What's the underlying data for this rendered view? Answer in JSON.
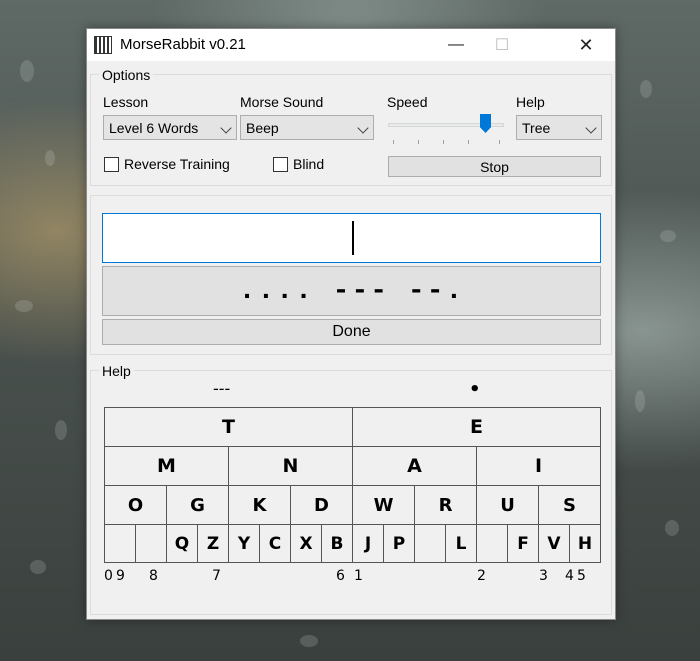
{
  "window": {
    "title": "MorseRabbit v0.21",
    "minimize": "—",
    "maximize": "☐",
    "close": "✕"
  },
  "options": {
    "legend": "Options",
    "lesson": {
      "label": "Lesson",
      "value": "Level 6 Words"
    },
    "sound": {
      "label": "Morse Sound",
      "value": "Beep"
    },
    "speed": {
      "label": "Speed",
      "level_fraction": 0.86
    },
    "help": {
      "label": "Help",
      "value": "Tree"
    },
    "reverse_training": {
      "label": "Reverse Training",
      "checked": false
    },
    "blind": {
      "label": "Blind",
      "checked": false
    },
    "stop_label": "Stop"
  },
  "training": {
    "input_value": "",
    "morse_code": ".... --- --.",
    "done_label": "Done"
  },
  "help_panel": {
    "legend": "Help",
    "dash_label": "---",
    "dot_label": "•",
    "level1": [
      "T",
      "E"
    ],
    "level2": [
      "M",
      "N",
      "A",
      "I"
    ],
    "level3": [
      "O",
      "G",
      "K",
      "D",
      "W",
      "R",
      "U",
      "S"
    ],
    "level4": [
      "",
      "",
      "Q",
      "Z",
      "Y",
      "C",
      "X",
      "B",
      "J",
      "P",
      "",
      "L",
      "",
      "F",
      "V",
      "H"
    ],
    "digits": [
      "0",
      "9",
      "8",
      "7",
      "6",
      "1",
      "2",
      "3",
      "4",
      "5"
    ]
  },
  "colors": {
    "accent": "#0078d7",
    "window_bg": "#f0f0f0"
  }
}
